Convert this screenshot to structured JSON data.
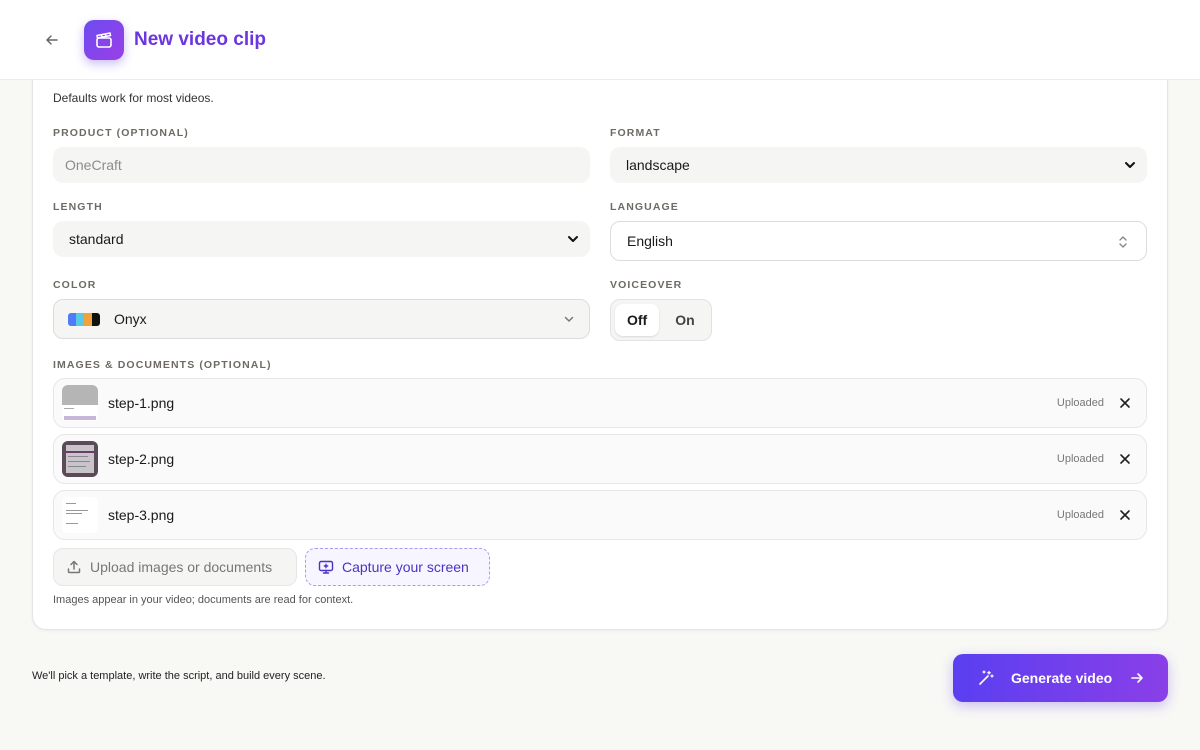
{
  "header": {
    "title": "New video clip",
    "back_icon": "arrow-left-icon",
    "app_icon": "clapperboard-icon"
  },
  "settings": {
    "subtitle": "Defaults work for most videos.",
    "product": {
      "label": "PRODUCT (OPTIONAL)",
      "placeholder": "OneCraft",
      "value": ""
    },
    "format": {
      "label": "FORMAT",
      "value": "landscape"
    },
    "length": {
      "label": "LENGTH",
      "value": "standard"
    },
    "language": {
      "label": "LANGUAGE",
      "value": "English"
    },
    "color": {
      "label": "COLOR",
      "value": "Onyx",
      "swatches": [
        "#4f7cf5",
        "#5cc8e8",
        "#f0a23c",
        "#111111"
      ]
    },
    "voiceover": {
      "label": "VOICEOVER",
      "options": [
        "Off",
        "On"
      ],
      "selected": "Off"
    }
  },
  "files": {
    "label": "IMAGES & DOCUMENTS (OPTIONAL)",
    "items": [
      {
        "name": "step-1.png",
        "status": "Uploaded"
      },
      {
        "name": "step-2.png",
        "status": "Uploaded"
      },
      {
        "name": "step-3.png",
        "status": "Uploaded"
      }
    ],
    "upload_label": "Upload images or documents",
    "capture_label": "Capture your screen",
    "hint": "Images appear in your video; documents are read for context."
  },
  "footer": {
    "note": "We'll pick a template, write the script, and build every scene.",
    "generate_label": "Generate video"
  },
  "colors": {
    "accent": "#6b35e0",
    "button_start": "#5a3ff0",
    "button_end": "#8a3fe8"
  }
}
